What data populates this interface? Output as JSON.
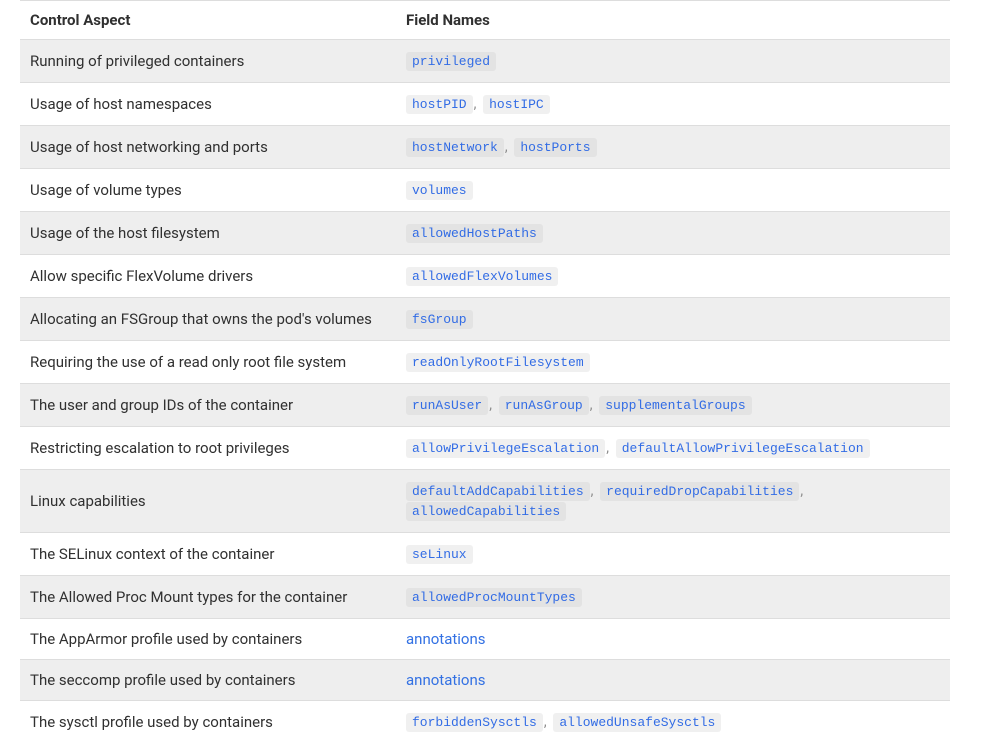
{
  "table": {
    "headers": [
      "Control Aspect",
      "Field Names"
    ],
    "rows": [
      {
        "aspect": "Running of privileged containers",
        "fields": [
          {
            "type": "code",
            "text": "privileged"
          }
        ]
      },
      {
        "aspect": "Usage of host namespaces",
        "fields": [
          {
            "type": "code",
            "text": "hostPID"
          },
          {
            "type": "sep",
            "text": ","
          },
          {
            "type": "code",
            "text": "hostIPC"
          }
        ]
      },
      {
        "aspect": "Usage of host networking and ports",
        "fields": [
          {
            "type": "code",
            "text": "hostNetwork"
          },
          {
            "type": "sep",
            "text": ","
          },
          {
            "type": "code",
            "text": "hostPorts"
          }
        ]
      },
      {
        "aspect": "Usage of volume types",
        "fields": [
          {
            "type": "code",
            "text": "volumes"
          }
        ]
      },
      {
        "aspect": "Usage of the host filesystem",
        "fields": [
          {
            "type": "code",
            "text": "allowedHostPaths"
          }
        ]
      },
      {
        "aspect": "Allow specific FlexVolume drivers",
        "fields": [
          {
            "type": "code",
            "text": "allowedFlexVolumes"
          }
        ]
      },
      {
        "aspect": "Allocating an FSGroup that owns the pod's volumes",
        "fields": [
          {
            "type": "code",
            "text": "fsGroup"
          }
        ]
      },
      {
        "aspect": "Requiring the use of a read only root file system",
        "fields": [
          {
            "type": "code",
            "text": "readOnlyRootFilesystem"
          }
        ]
      },
      {
        "aspect": "The user and group IDs of the container",
        "fields": [
          {
            "type": "code",
            "text": "runAsUser"
          },
          {
            "type": "sep",
            "text": ","
          },
          {
            "type": "code",
            "text": "runAsGroup"
          },
          {
            "type": "sep",
            "text": ","
          },
          {
            "type": "code",
            "text": "supplementalGroups"
          }
        ]
      },
      {
        "aspect": "Restricting escalation to root privileges",
        "fields": [
          {
            "type": "code",
            "text": "allowPrivilegeEscalation"
          },
          {
            "type": "sep",
            "text": ","
          },
          {
            "type": "code",
            "text": "defaultAllowPrivilegeEscalation"
          }
        ]
      },
      {
        "aspect": "Linux capabilities",
        "fields": [
          {
            "type": "code",
            "text": "defaultAddCapabilities"
          },
          {
            "type": "sep",
            "text": ","
          },
          {
            "type": "code",
            "text": "requiredDropCapabilities"
          },
          {
            "type": "sep",
            "text": ","
          },
          {
            "type": "code",
            "text": "allowedCapabilities"
          }
        ]
      },
      {
        "aspect": "The SELinux context of the container",
        "fields": [
          {
            "type": "code",
            "text": "seLinux"
          }
        ]
      },
      {
        "aspect": "The Allowed Proc Mount types for the container",
        "fields": [
          {
            "type": "code",
            "text": "allowedProcMountTypes"
          }
        ]
      },
      {
        "aspect": "The AppArmor profile used by containers",
        "fields": [
          {
            "type": "link",
            "text": "annotations"
          }
        ]
      },
      {
        "aspect": "The seccomp profile used by containers",
        "fields": [
          {
            "type": "link",
            "text": "annotations"
          }
        ]
      },
      {
        "aspect": "The sysctl profile used by containers",
        "fields": [
          {
            "type": "code",
            "text": "forbiddenSysctls"
          },
          {
            "type": "sep",
            "text": ","
          },
          {
            "type": "code",
            "text": "allowedUnsafeSysctls"
          }
        ]
      }
    ]
  }
}
